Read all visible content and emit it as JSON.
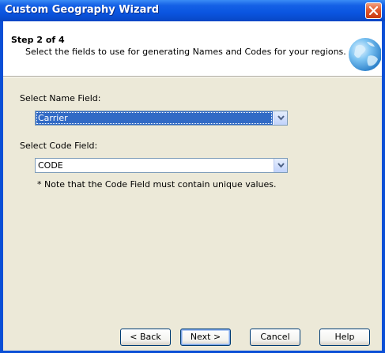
{
  "window": {
    "title": "Custom Geography Wizard"
  },
  "header": {
    "step": "Step 2 of 4",
    "description": "Select the fields to use for generating Names and Codes for your regions."
  },
  "form": {
    "name_label": "Select Name Field:",
    "name_value": "Carrier",
    "code_label": "Select Code Field:",
    "code_value": "CODE",
    "note": "* Note that the Code Field must contain unique values."
  },
  "buttons": {
    "back": "< Back",
    "next": "Next >",
    "cancel": "Cancel",
    "help": "Help"
  },
  "icons": {
    "close": "close-icon",
    "globe": "globe-icon",
    "dropdown": "chevron-down-icon"
  },
  "colors": {
    "titlebar": "#0a55e0",
    "selection": "#316ac5",
    "dialog_bg": "#ece9d8"
  }
}
